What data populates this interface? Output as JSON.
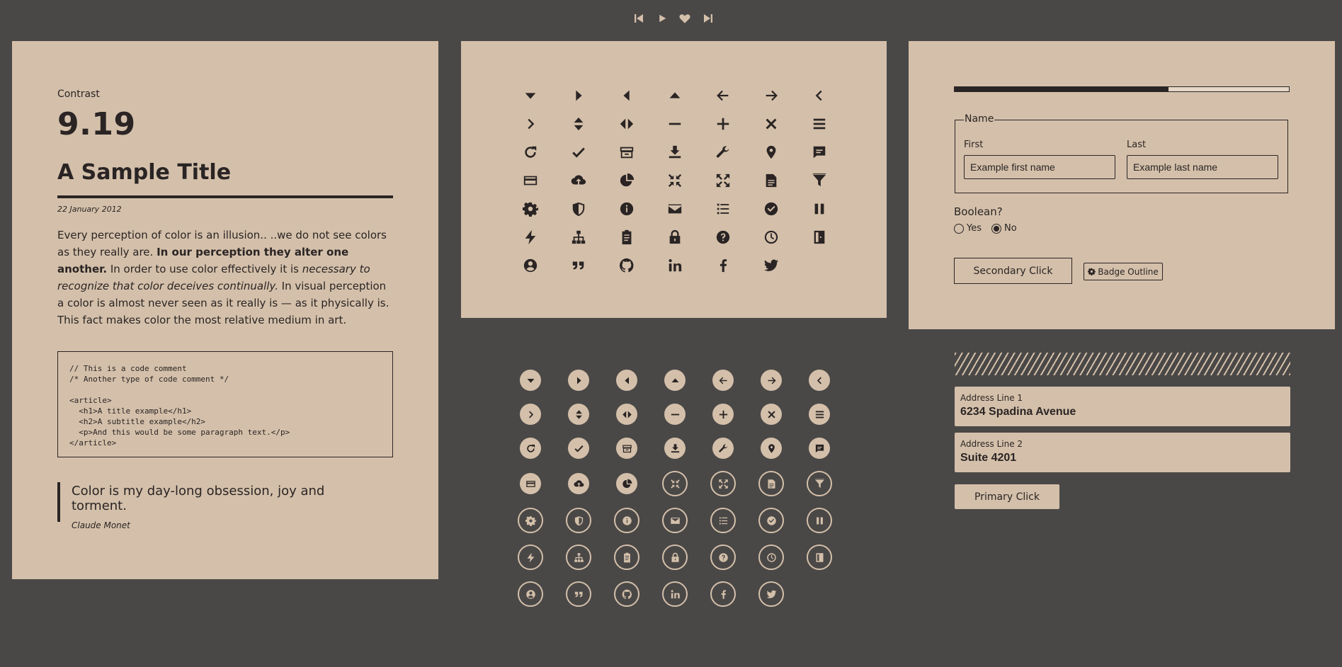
{
  "player": {
    "icons": [
      "skip-back-icon",
      "play-icon",
      "heart-icon",
      "skip-forward-icon"
    ]
  },
  "contrast": {
    "label": "Contrast",
    "value": "9.19"
  },
  "article": {
    "title": "A Sample Title",
    "date": "22 January 2012",
    "p1": "Every perception of color is an illusion.. ..we do not see colors as they really are. ",
    "p_bold": "In our perception they alter one another.",
    "p2": " In order to use color effectively it is ",
    "p_italic": "necessary to recognize that color deceives continually.",
    "p3": " In visual perception a color is almost never seen as it really is — as it physically is. This fact makes color the most relative medium in art."
  },
  "code": "// This is a code comment\n/* Another type of code comment */\n\n<article>\n  <h1>A title example</h1>\n  <h2>A subtitle example</h2>\n  <p>And this would be some paragraph text.</p>\n</article>",
  "quote": {
    "text": "Color is my day-long obsession, joy and torment.",
    "author": "Claude Monet"
  },
  "icons": [
    "caret-down",
    "caret-right",
    "caret-left",
    "caret-up",
    "arrow-left",
    "arrow-right",
    "chevron-left",
    "chevron-right",
    "sort",
    "code",
    "minus",
    "plus",
    "close",
    "menu",
    "refresh",
    "check",
    "archive",
    "download",
    "wrench",
    "map-pin",
    "chat",
    "credit-card",
    "cloud-upload",
    "pie-chart",
    "compress",
    "expand",
    "document",
    "filter",
    "gear",
    "shield",
    "info",
    "mail",
    "list",
    "check-circle",
    "pause",
    "bolt",
    "sitemap",
    "clipboard",
    "lock",
    "question",
    "clock",
    "door",
    "user",
    "quote",
    "github",
    "linkedin",
    "facebook",
    "twitter"
  ],
  "progress": {
    "value": 0.64
  },
  "name_group": {
    "legend": "Name",
    "first_label": "First",
    "first_placeholder": "Example first name",
    "last_label": "Last",
    "last_placeholder": "Example last name"
  },
  "boolean": {
    "label": "Boolean?",
    "yes": "Yes",
    "no": "No",
    "selected": "No"
  },
  "buttons": {
    "secondary": "Secondary Click",
    "badge": "Badge Outline",
    "primary": "Primary Click"
  },
  "address": {
    "line1_label": "Address Line 1",
    "line1_value": "6234 Spadina Avenue",
    "line2_label": "Address Line 2",
    "line2_value": "Suite 4201"
  }
}
